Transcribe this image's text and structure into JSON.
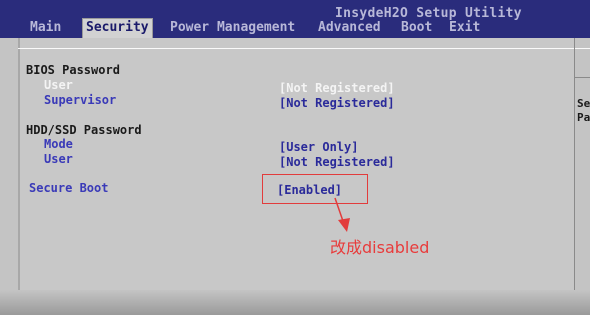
{
  "app_title": "InsydeH2O Setup Utility",
  "tabs": [
    {
      "label": "Main"
    },
    {
      "label": "Security"
    },
    {
      "label": "Power Management"
    },
    {
      "label": "Advanced"
    },
    {
      "label": "Boot"
    },
    {
      "label": "Exit"
    }
  ],
  "active_tab": "Security",
  "bios_password": {
    "header": "BIOS Password",
    "user_label": "User",
    "user_value": "[Not Registered]",
    "supervisor_label": "Supervisor",
    "supervisor_value": "[Not Registered]"
  },
  "hdd_password": {
    "header": "HDD/SSD Password",
    "mode_label": "Mode",
    "mode_value": "[User Only]",
    "user_label": "User",
    "user_value": "[Not Registered]"
  },
  "secure_boot": {
    "label": "Secure Boot",
    "value": "[Enabled]"
  },
  "help_panel": {
    "line1": "Se",
    "line2": "Pa"
  },
  "annotation": {
    "text": "改成disabled",
    "color": "#e83c3c"
  }
}
